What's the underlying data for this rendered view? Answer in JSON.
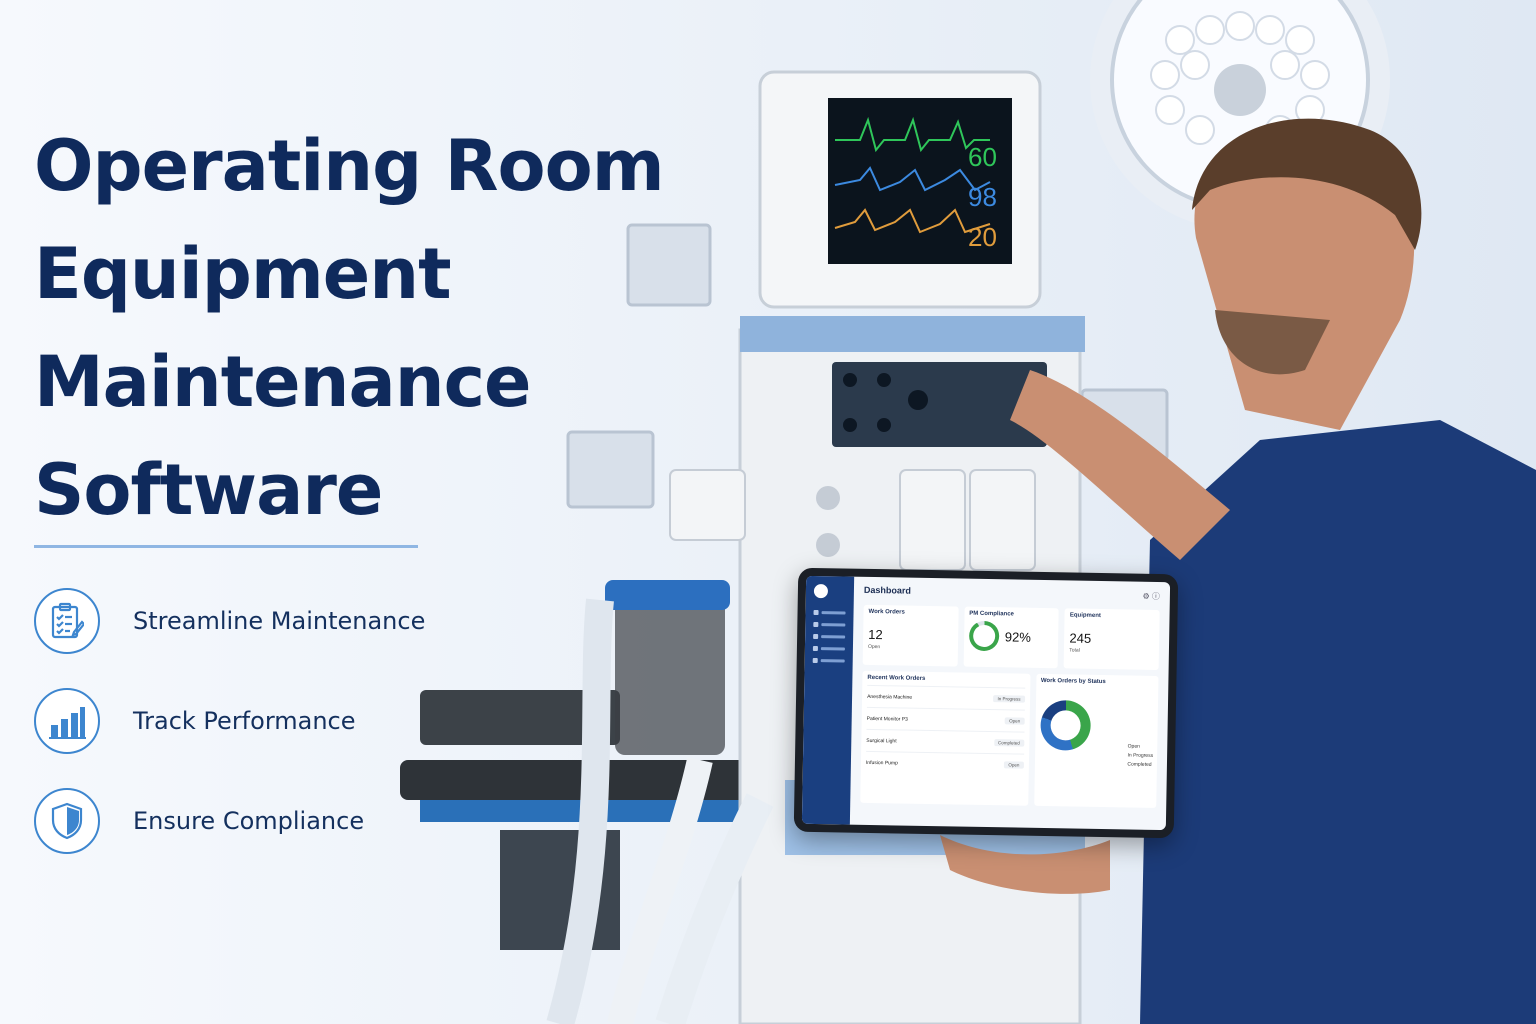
{
  "headline": {
    "line1": "Operating Room",
    "line2": "Equipment",
    "line3": "Maintenance",
    "line4": "Software"
  },
  "features": [
    {
      "icon": "clipboard-checklist-icon",
      "label": "Streamline Maintenance"
    },
    {
      "icon": "bar-chart-icon",
      "label": "Track Performance"
    },
    {
      "icon": "shield-icon",
      "label": "Ensure Compliance"
    }
  ],
  "tablet": {
    "title": "Dashboard",
    "cards": {
      "work_orders": {
        "title": "Work Orders",
        "value": "12",
        "sub": "Open"
      },
      "pm_compliance": {
        "title": "PM Compliance",
        "value": "92%"
      },
      "equipment": {
        "title": "Equipment",
        "value": "245",
        "sub": "Total"
      }
    },
    "recent_title": "Recent Work Orders",
    "recent": [
      {
        "name": "Anesthesia Machine",
        "status": "In Progress"
      },
      {
        "name": "Patient Monitor P3",
        "status": "Open"
      },
      {
        "name": "Surgical Light",
        "status": "Completed"
      },
      {
        "name": "Infusion Pump",
        "status": "Open"
      }
    ],
    "status_title": "Work Orders by Status",
    "legend": [
      "Open",
      "In Progress",
      "Completed"
    ]
  },
  "colors": {
    "headline": "#0f2a5c",
    "accent": "#3d86cf",
    "sidebar": "#1a3f80"
  }
}
